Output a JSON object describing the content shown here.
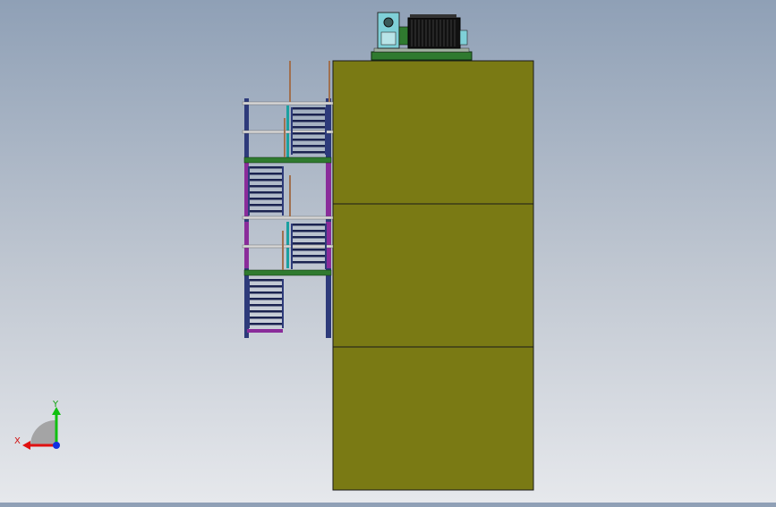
{
  "viewport": {
    "description_free": true,
    "background_top": "#8fa0b6",
    "background_bottom": "#e6e8ec"
  },
  "model": {
    "tower_color": "#7a7a14",
    "tower_edge_color": "#1a1a1a",
    "platform_color": "#2f7a2f",
    "stair_frame_color": "#2d3a7a",
    "stair_brace_color": "#8a2c9a",
    "rail_color": "#d8d8d8",
    "motor_color": "#111111",
    "housing_color": "#7fd0d8",
    "panel_count": 3,
    "landing_count": 2
  },
  "triad": {
    "x_label": "X",
    "y_label": "Y",
    "x_color": "#e01010",
    "y_color": "#10c010",
    "z_color": "#1030e0"
  }
}
